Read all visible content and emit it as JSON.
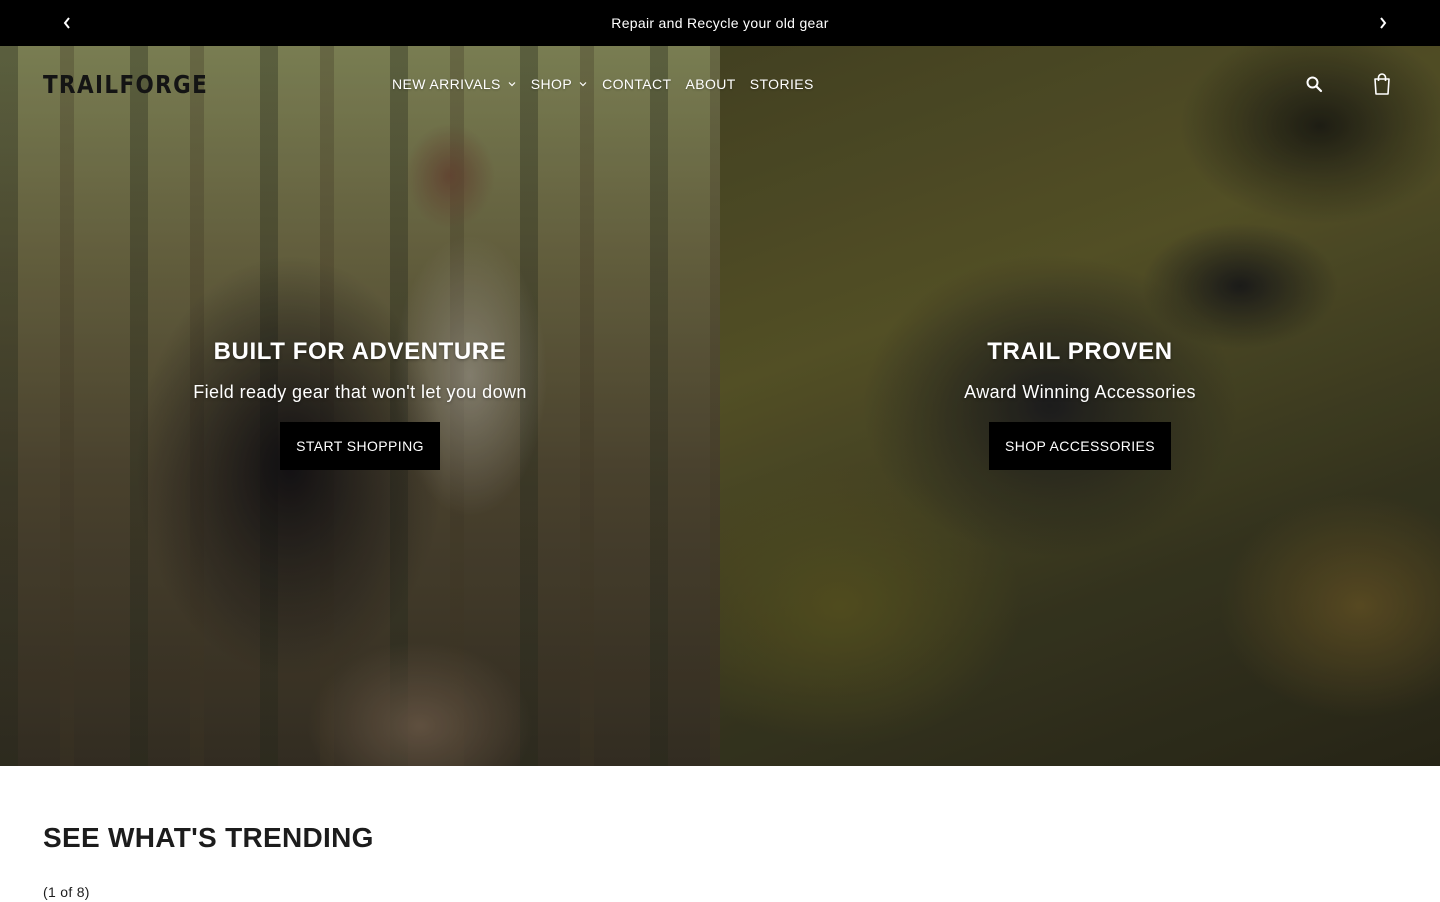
{
  "announcement": {
    "message": "Repair and Recycle your old gear",
    "prev_icon": "chevron-left-icon",
    "next_icon": "chevron-right-icon"
  },
  "header": {
    "logo": "TRAILFORGE",
    "nav": [
      {
        "label": "NEW ARRIVALS",
        "has_dropdown": true
      },
      {
        "label": "SHOP",
        "has_dropdown": true
      },
      {
        "label": "CONTACT",
        "has_dropdown": false
      },
      {
        "label": "ABOUT",
        "has_dropdown": false
      },
      {
        "label": "STORIES",
        "has_dropdown": false
      }
    ],
    "icons": [
      "search-icon",
      "bag-icon"
    ]
  },
  "hero": {
    "left": {
      "title": "BUILT FOR ADVENTURE",
      "subtitle": "Field ready gear that won't let you down",
      "button": "START SHOPPING"
    },
    "right": {
      "title": "TRAIL PROVEN",
      "subtitle": "Award Winning Accessories",
      "button": "SHOP ACCESSORIES"
    }
  },
  "trending": {
    "title": "SEE WHAT'S TRENDING",
    "counter": "(1 of 8)"
  },
  "colors": {
    "announcement_bg": "#000000",
    "button_bg": "#000000",
    "text_light": "#ffffff",
    "text_dark": "#1c1c1c"
  }
}
